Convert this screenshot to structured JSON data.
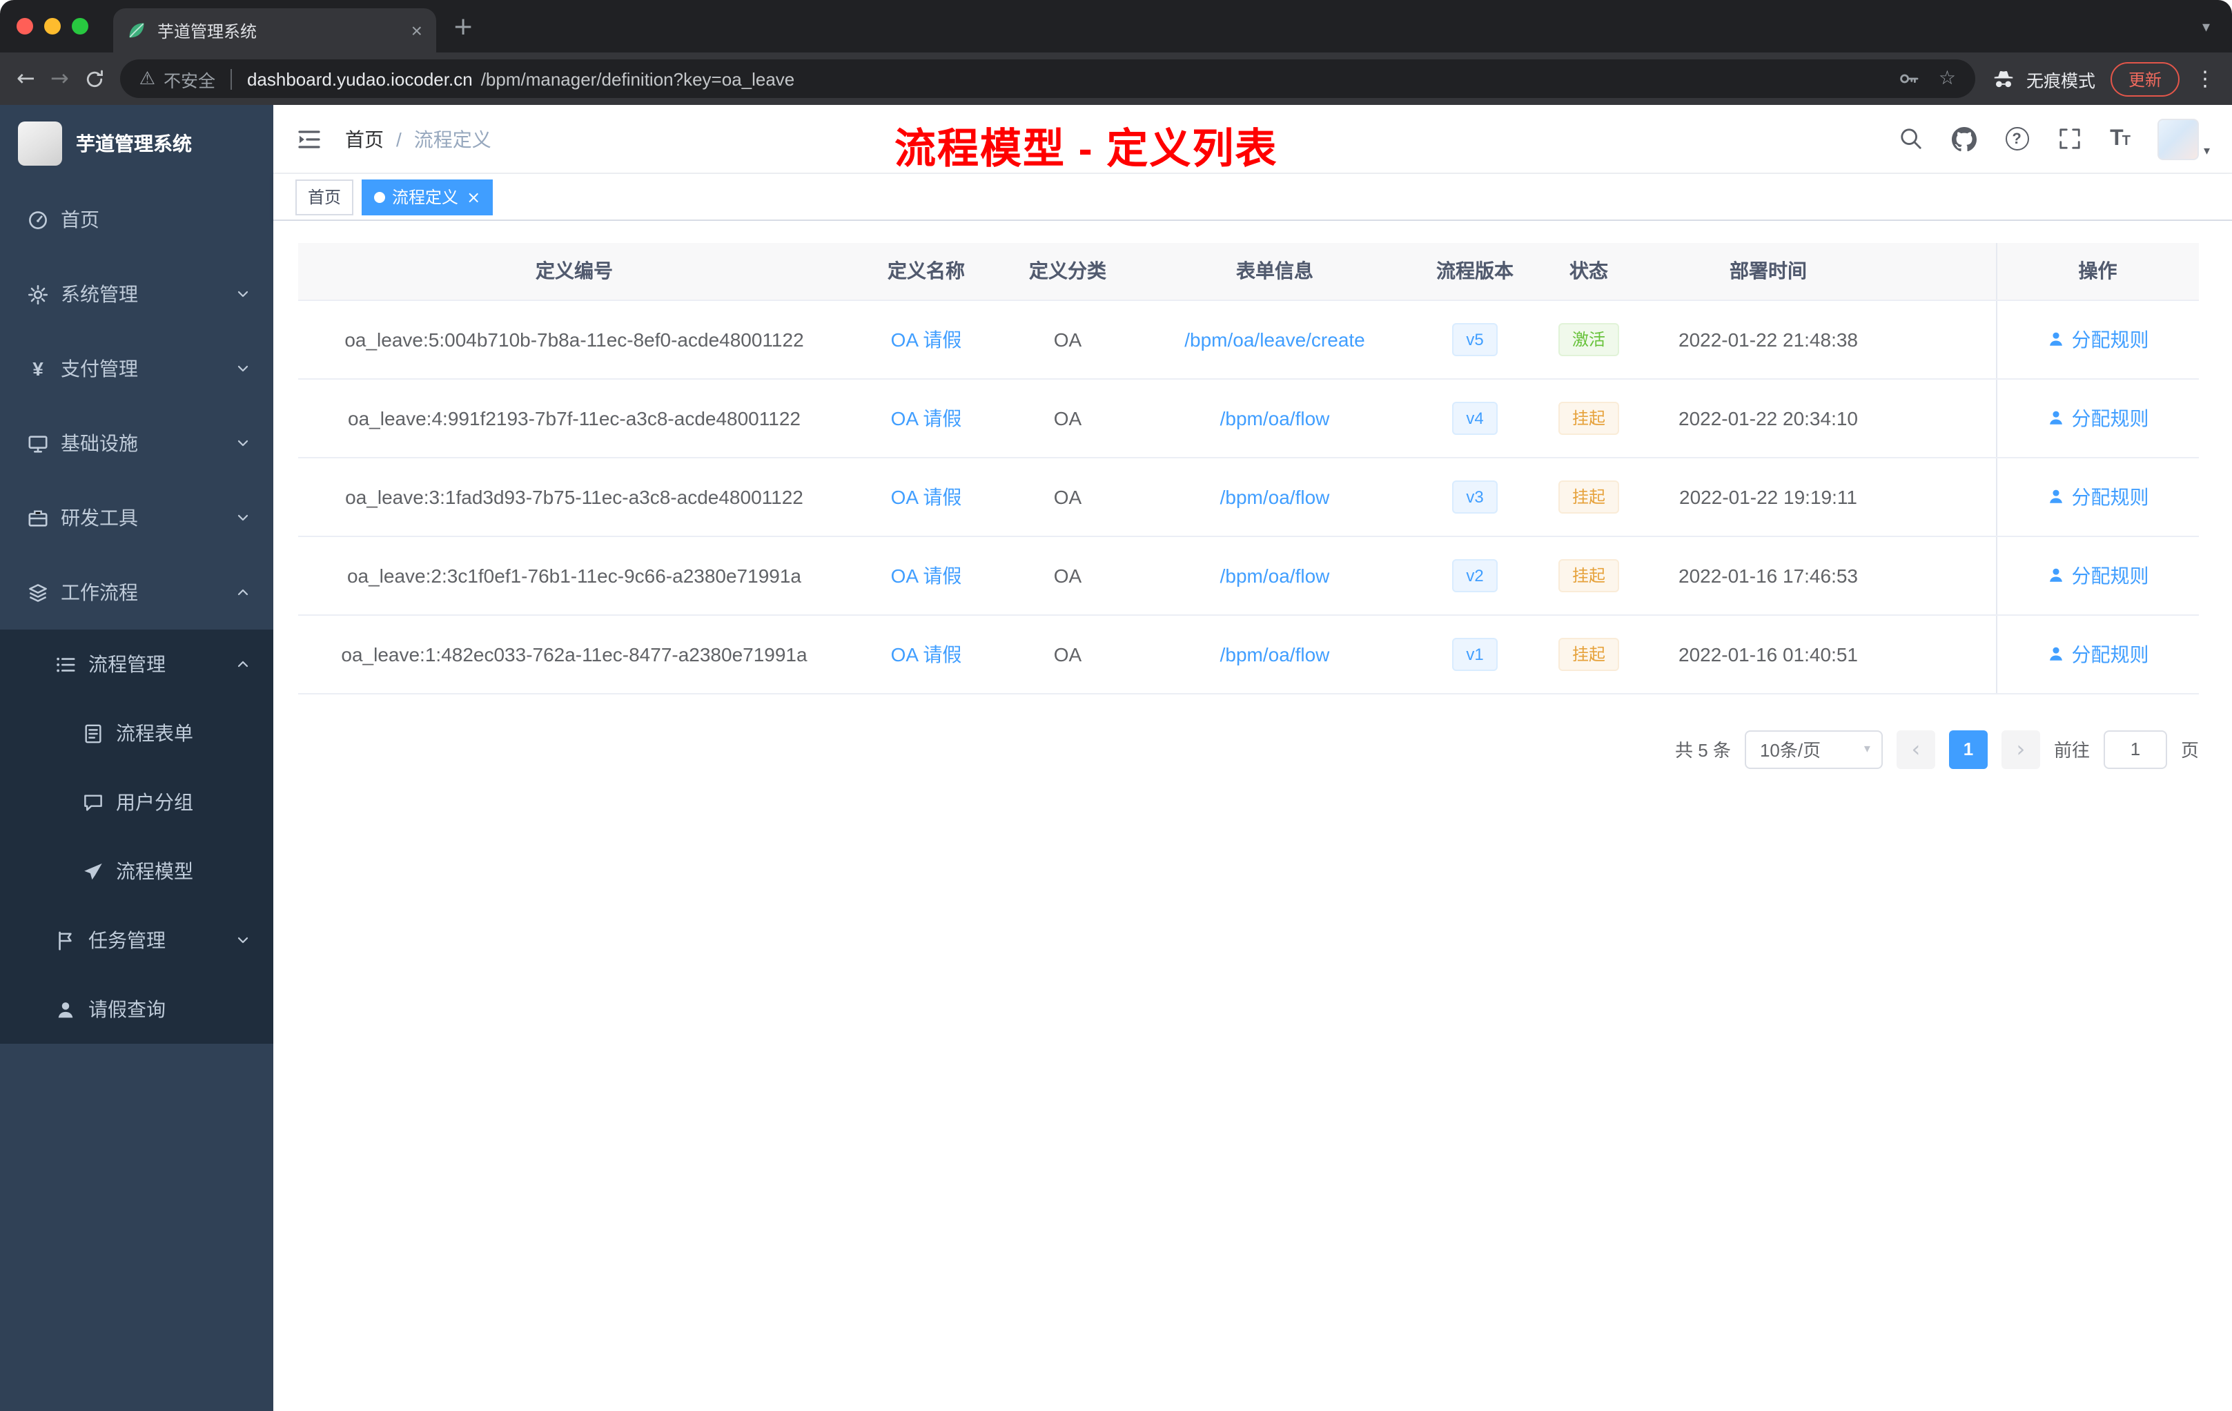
{
  "colors": {
    "accent": "#409eff",
    "annotation_red": "#ff0000",
    "status_active_green": "#67c23a",
    "status_suspended_orange": "#e6a23c",
    "sidebar_bg": "#304156",
    "sidebar_submenu_bg": "#1f2d3d",
    "active_tag_bg": "#409eff"
  },
  "icons": {
    "close": "×",
    "plus": "+",
    "tab_caret": "▾",
    "back": "←",
    "forward": "→",
    "warning": "⚠",
    "star": "☆",
    "more": "⋮",
    "yen": "¥",
    "question": "?",
    "font_large": "T",
    "font_small": "T",
    "caret_down": "▾",
    "select_caret": "▾",
    "prev": "‹",
    "next": "›"
  },
  "browser": {
    "tab_title": "芋道管理系统",
    "security_label": "不安全",
    "url_host": "dashboard.yudao.iocoder.cn",
    "url_path": "/bpm/manager/definition?key=oa_leave",
    "incognito_label": "无痕模式",
    "update_label": "更新"
  },
  "sidebar": {
    "logo_title": "芋道管理系统",
    "home": "首页",
    "system": "系统管理",
    "payment": "支付管理",
    "infra": "基础设施",
    "devtools": "研发工具",
    "workflow": "工作流程",
    "process_mgmt": "流程管理",
    "process_form": "流程表单",
    "user_group": "用户分组",
    "process_model": "流程模型",
    "task_mgmt": "任务管理",
    "leave_query": "请假查询"
  },
  "navbar": {
    "breadcrumb_home": "首页",
    "breadcrumb_sep": "/",
    "breadcrumb_current": "流程定义"
  },
  "annotation": "流程模型 - 定义列表",
  "tags": {
    "home": "首页",
    "active": "流程定义"
  },
  "table": {
    "columns": [
      "定义编号",
      "定义名称",
      "定义分类",
      "表单信息",
      "流程版本",
      "状态",
      "部署时间",
      "操作"
    ],
    "rows": [
      {
        "id": "oa_leave:5:004b710b-7b8a-11ec-8ef0-acde48001122",
        "name": "OA 请假",
        "category": "OA",
        "form": "/bpm/oa/leave/create",
        "version": "v5",
        "status": "激活",
        "time": "2022-01-22 21:48:38",
        "action": "分配规则"
      },
      {
        "id": "oa_leave:4:991f2193-7b7f-11ec-a3c8-acde48001122",
        "name": "OA 请假",
        "category": "OA",
        "form": "/bpm/oa/flow",
        "version": "v4",
        "status": "挂起",
        "time": "2022-01-22 20:34:10",
        "action": "分配规则"
      },
      {
        "id": "oa_leave:3:1fad3d93-7b75-11ec-a3c8-acde48001122",
        "name": "OA 请假",
        "category": "OA",
        "form": "/bpm/oa/flow",
        "version": "v3",
        "status": "挂起",
        "time": "2022-01-22 19:19:11",
        "action": "分配规则"
      },
      {
        "id": "oa_leave:2:3c1f0ef1-76b1-11ec-9c66-a2380e71991a",
        "name": "OA 请假",
        "category": "OA",
        "form": "/bpm/oa/flow",
        "version": "v2",
        "status": "挂起",
        "time": "2022-01-16 17:46:53",
        "action": "分配规则"
      },
      {
        "id": "oa_leave:1:482ec033-762a-11ec-8477-a2380e71991a",
        "name": "OA 请假",
        "category": "OA",
        "form": "/bpm/oa/flow",
        "version": "v1",
        "status": "挂起",
        "time": "2022-01-16 01:40:51",
        "action": "分配规则"
      }
    ]
  },
  "pagination": {
    "total": "共 5 条",
    "page_size": "10条/页",
    "page": "1",
    "goto_label": "前往",
    "goto_value": "1",
    "goto_unit": "页"
  }
}
